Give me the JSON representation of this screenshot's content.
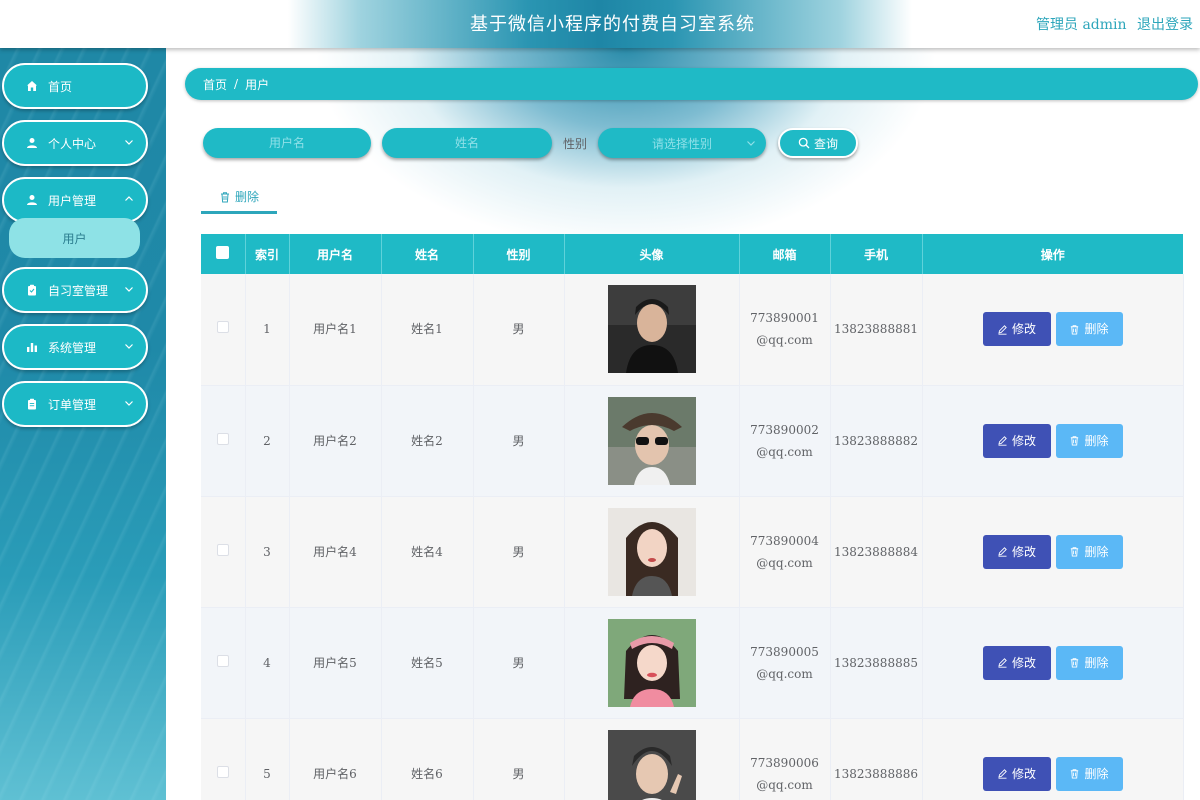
{
  "header": {
    "title": "基于微信小程序的付费自习室系统",
    "admin_label": "管理员 admin",
    "logout_label": "退出登录"
  },
  "sidebar": {
    "items": [
      {
        "label": "首页",
        "icon": "home-icon"
      },
      {
        "label": "个人中心",
        "icon": "user-icon"
      },
      {
        "label": "用户管理",
        "icon": "user-icon"
      },
      {
        "label": "自习室管理",
        "icon": "clipboard-icon"
      },
      {
        "label": "系统管理",
        "icon": "bar-chart-icon"
      },
      {
        "label": "订单管理",
        "icon": "clipboard-icon"
      }
    ],
    "active_sub": "用户"
  },
  "breadcrumb": {
    "home": "首页",
    "separator": "/",
    "current": "用户"
  },
  "search": {
    "username_placeholder": "用户名",
    "name_placeholder": "姓名",
    "gender_label": "性别",
    "gender_placeholder": "请选择性别",
    "query_label": "查询"
  },
  "toolbar": {
    "delete_label": "删除"
  },
  "table": {
    "columns": [
      "索引",
      "用户名",
      "姓名",
      "性别",
      "头像",
      "邮箱",
      "手机",
      "操作"
    ],
    "edit_label": "修改",
    "delete_label": "删除",
    "rows": [
      {
        "index": "1",
        "username": "用户名1",
        "name": "姓名1",
        "gender": "男",
        "email": "773890001@qq.com",
        "phone": "13823888881"
      },
      {
        "index": "2",
        "username": "用户名2",
        "name": "姓名2",
        "gender": "男",
        "email": "773890002@qq.com",
        "phone": "13823888882"
      },
      {
        "index": "3",
        "username": "用户名4",
        "name": "姓名4",
        "gender": "男",
        "email": "773890004@qq.com",
        "phone": "13823888884"
      },
      {
        "index": "4",
        "username": "用户名5",
        "name": "姓名5",
        "gender": "男",
        "email": "773890005@qq.com",
        "phone": "13823888885"
      },
      {
        "index": "5",
        "username": "用户名6",
        "name": "姓名6",
        "gender": "男",
        "email": "773890006@qq.com",
        "phone": "13823888886"
      }
    ]
  },
  "colors": {
    "primary": "#1fbac6",
    "sidebar": "#1f88a6",
    "edit_button": "#3f51b5",
    "delete_button": "#5bb8f6",
    "link": "#2da6bb"
  }
}
